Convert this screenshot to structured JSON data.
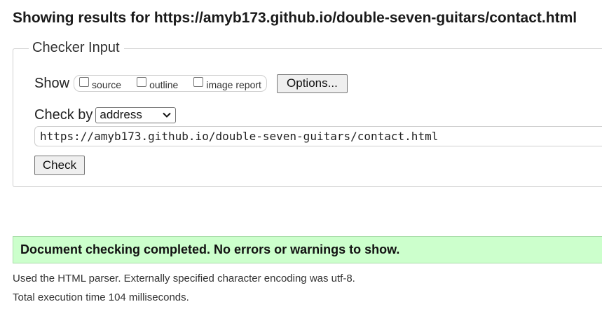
{
  "heading": "Showing results for https://amyb173.github.io/double-seven-guitars/contact.html",
  "checker": {
    "legend": "Checker Input",
    "show_label": "Show",
    "checkboxes": [
      {
        "label": "source",
        "checked": false
      },
      {
        "label": "outline",
        "checked": false
      },
      {
        "label": "image report",
        "checked": false
      }
    ],
    "options_button": "Options...",
    "check_by_label": "Check by",
    "check_by_selected": "address",
    "url_value": "https://amyb173.github.io/double-seven-guitars/contact.html",
    "check_button": "Check"
  },
  "result": {
    "success_message": "Document checking completed. No errors or warnings to show.",
    "parser_info": "Used the HTML parser. Externally specified character encoding was utf-8.",
    "execution_time": "Total execution time 104 milliseconds."
  },
  "colors": {
    "success_background": "#ccffcc",
    "button_background": "#efefef"
  }
}
